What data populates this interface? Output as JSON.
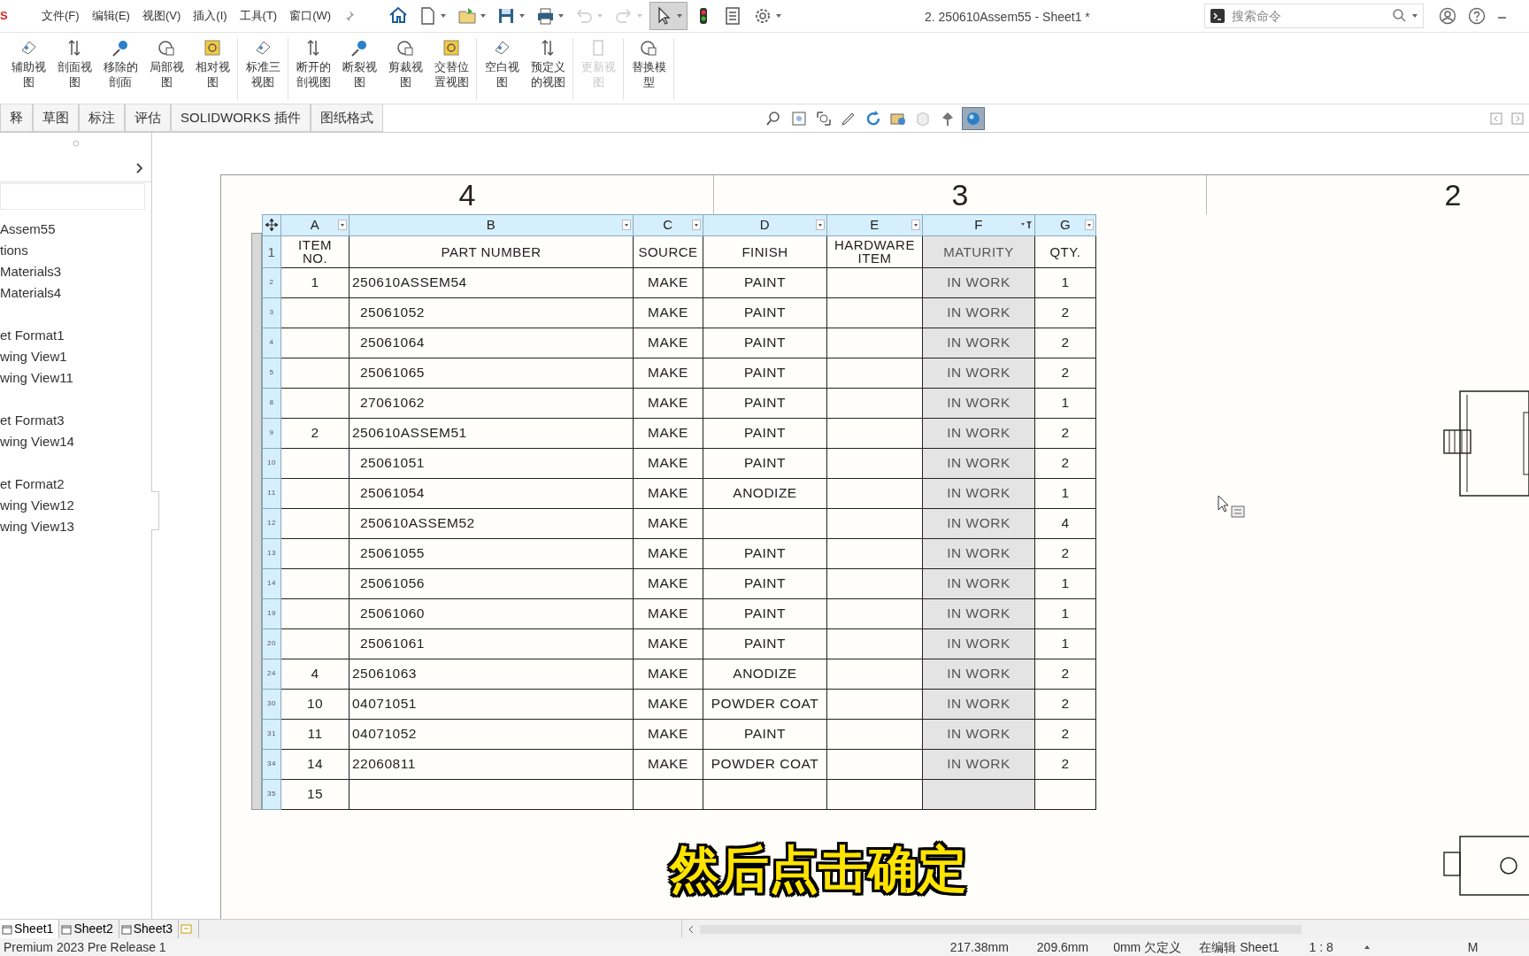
{
  "app_logo": "S",
  "menu": [
    "文件(F)",
    "编辑(E)",
    "视图(V)",
    "插入(I)",
    "工具(T)",
    "窗口(W)"
  ],
  "quick_tools": [
    {
      "disabled": false,
      "pressed": false,
      "dropdown": false
    },
    {
      "disabled": false,
      "pressed": false,
      "dropdown": true
    },
    {
      "disabled": false,
      "pressed": false,
      "dropdown": true
    },
    {
      "disabled": false,
      "pressed": false,
      "dropdown": true
    },
    {
      "disabled": false,
      "pressed": false,
      "dropdown": true
    },
    {
      "disabled": true,
      "pressed": false,
      "dropdown": true
    },
    {
      "disabled": true,
      "pressed": false,
      "dropdown": true
    },
    {
      "disabled": false,
      "pressed": true,
      "dropdown": true
    },
    {
      "disabled": false,
      "pressed": false,
      "dropdown": false
    },
    {
      "disabled": false,
      "pressed": false,
      "dropdown": false
    },
    {
      "disabled": false,
      "pressed": false,
      "dropdown": true
    }
  ],
  "document_title": "2. 250610Assem55 - Sheet1 *",
  "search": {
    "placeholder": "搜索命令"
  },
  "ribbon_groups": [
    [
      {
        "label": "辅助视图",
        "disabled": false
      },
      {
        "label": "剖面视图",
        "disabled": false
      },
      {
        "label": "移除的剖面",
        "disabled": false
      },
      {
        "label": "局部视图",
        "disabled": false
      },
      {
        "label": "相对视图",
        "disabled": false
      }
    ],
    [
      {
        "label": "标准三视图",
        "disabled": false
      }
    ],
    [
      {
        "label": "断开的剖视图",
        "disabled": false
      },
      {
        "label": "断裂视图",
        "disabled": false
      },
      {
        "label": "剪裁视图",
        "disabled": false
      },
      {
        "label": "交替位置视图",
        "disabled": false
      }
    ],
    [
      {
        "label": "空白视图",
        "disabled": false
      },
      {
        "label": "预定义的视图",
        "disabled": false
      }
    ],
    [
      {
        "label": "更新视图",
        "disabled": true
      }
    ],
    [
      {
        "label": "替换模型",
        "disabled": false
      }
    ]
  ],
  "command_tabs": [
    "释",
    "草图",
    "标注",
    "评估",
    "SOLIDWORKS 插件",
    "图纸格式"
  ],
  "view_tools": [
    {
      "pressed": false
    },
    {
      "pressed": false
    },
    {
      "pressed": false
    },
    {
      "pressed": false
    },
    {
      "pressed": false
    },
    {
      "pressed": false
    },
    {
      "pressed": false
    },
    {
      "pressed": false
    },
    {
      "pressed": true
    }
  ],
  "feature_tree": [
    [
      "Assem55",
      "tions",
      "Materials3",
      "Materials4"
    ],
    [
      "et Format1",
      "wing View1",
      "wing View11"
    ],
    [
      "et Format3",
      "wing View14"
    ],
    [
      "et Format2",
      "wing View12",
      "wing View13"
    ]
  ],
  "zones": [
    "4",
    "3",
    "2"
  ],
  "bom": {
    "columns": [
      {
        "letter": "A",
        "heading": "ITEM\nNO.",
        "selected": false,
        "filtered": false
      },
      {
        "letter": "B",
        "heading": "PART NUMBER",
        "selected": false,
        "filtered": false
      },
      {
        "letter": "C",
        "heading": "SOURCE",
        "selected": false,
        "filtered": false
      },
      {
        "letter": "D",
        "heading": "FINISH",
        "selected": false,
        "filtered": false
      },
      {
        "letter": "E",
        "heading": "HARDWARE\nITEM",
        "selected": false,
        "filtered": false
      },
      {
        "letter": "F",
        "heading": "MATURITY",
        "selected": true,
        "filtered": true
      },
      {
        "letter": "G",
        "heading": "QTY.",
        "selected": false,
        "filtered": false
      }
    ],
    "heading_row": "1",
    "rows": [
      {
        "row": "2",
        "item": "1",
        "part": "250610ASSEM54",
        "source": "MAKE",
        "finish": "PAINT",
        "maturity": "IN WORK",
        "qty": "1",
        "children": [
          {
            "row": "3",
            "part": "25061052",
            "source": "MAKE",
            "finish": "PAINT",
            "maturity": "IN WORK",
            "qty": "2"
          },
          {
            "row": "4",
            "part": "25061064",
            "source": "MAKE",
            "finish": "PAINT",
            "maturity": "IN WORK",
            "qty": "2"
          },
          {
            "row": "5",
            "part": "25061065",
            "source": "MAKE",
            "finish": "PAINT",
            "maturity": "IN WORK",
            "qty": "2"
          },
          {
            "row": "8",
            "part": "27061062",
            "source": "MAKE",
            "finish": "PAINT",
            "maturity": "IN WORK",
            "qty": "1"
          }
        ]
      },
      {
        "row": "9",
        "item": "2",
        "part": "250610ASSEM51",
        "source": "MAKE",
        "finish": "PAINT",
        "maturity": "IN WORK",
        "qty": "2",
        "children": [
          {
            "row": "10",
            "part": "25061051",
            "source": "MAKE",
            "finish": "PAINT",
            "maturity": "IN WORK",
            "qty": "2"
          },
          {
            "row": "11",
            "part": "25061054",
            "source": "MAKE",
            "finish": "ANODIZE",
            "maturity": "IN WORK",
            "qty": "1"
          },
          {
            "row": "12",
            "part": "250610ASSEM52",
            "source": "MAKE",
            "maturity": "IN WORK",
            "qty": "4"
          },
          {
            "row": "13",
            "part": "25061055",
            "source": "MAKE",
            "finish": "PAINT",
            "maturity": "IN WORK",
            "qty": "2"
          },
          {
            "row": "14",
            "part": "25061056",
            "source": "MAKE",
            "finish": "PAINT",
            "maturity": "IN WORK",
            "qty": "1"
          },
          {
            "row": "19",
            "part": "25061060",
            "source": "MAKE",
            "finish": "PAINT",
            "maturity": "IN WORK",
            "qty": "1"
          },
          {
            "row": "20",
            "part": "25061061",
            "source": "MAKE",
            "finish": "PAINT",
            "maturity": "IN WORK",
            "qty": "1"
          }
        ]
      },
      {
        "row": "24",
        "item": "4",
        "part": "25061063",
        "source": "MAKE",
        "finish": "ANODIZE",
        "maturity": "IN WORK",
        "qty": "2"
      },
      {
        "row": "30",
        "item": "10",
        "part": "04071051",
        "source": "MAKE",
        "finish": "POWDER COAT",
        "maturity": "IN WORK",
        "qty": "2"
      },
      {
        "row": "31",
        "item": "11",
        "part": "04071052",
        "source": "MAKE",
        "finish": "PAINT",
        "maturity": "IN WORK",
        "qty": "2"
      },
      {
        "row": "34",
        "item": "14",
        "part": "22060811",
        "source": "MAKE",
        "finish": "POWDER COAT",
        "maturity": "IN WORK",
        "qty": "2"
      },
      {
        "row": "35",
        "item": "15"
      }
    ]
  },
  "caption": "然后点击确定",
  "sheet_tabs": [
    {
      "label": "Sheet1",
      "selected": true
    },
    {
      "label": "Sheet2",
      "selected": false
    },
    {
      "label": "Sheet3",
      "selected": false
    }
  ],
  "status_bar": {
    "product": "Premium 2023 Pre Release 1",
    "x": "217.38mm",
    "y": "209.6mm",
    "z": "0mm",
    "definition": "欠定义",
    "editing": "在编辑 Sheet1",
    "scale": "1 : 8",
    "units": "M"
  }
}
